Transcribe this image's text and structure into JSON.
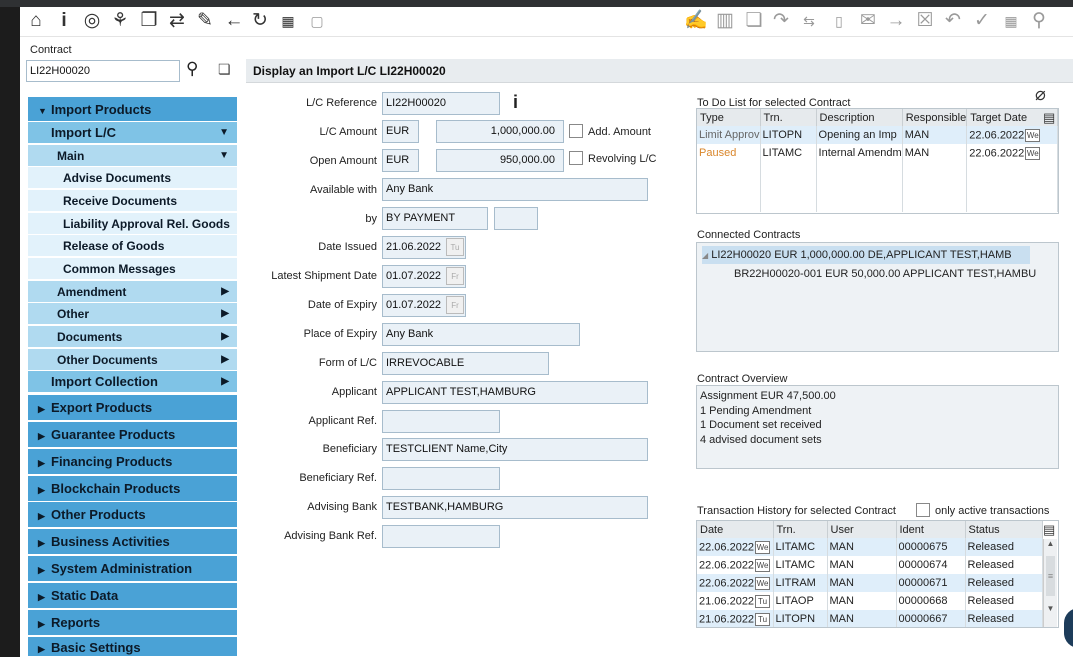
{
  "toolbar_left": [
    "home-icon",
    "info-icon",
    "swirl-icon",
    "tree-icon",
    "book-icon",
    "flow-icon",
    "edit-icon",
    "back-arrow-icon",
    "refresh-icon",
    "calendar-icon",
    "info-box-icon"
  ],
  "toolbar_right": [
    "edit-doc-icon",
    "trash-icon",
    "doc-edit-icon",
    "redo-icon",
    "swap-icon",
    "info-box-icon",
    "mail-icon",
    "forward-icon",
    "close-box-icon",
    "undo-icon",
    "check-icon",
    "calendar-icon",
    "search-icon"
  ],
  "contract": {
    "label": "Contract",
    "value": "LI22H00020"
  },
  "header": {
    "title": "Display an Import L/C LI22H00020"
  },
  "sidebar": {
    "import_products": "Import Products",
    "import_lc": "Import L/C",
    "main": "Main",
    "advise": "Advise Documents",
    "receive": "Receive Documents",
    "liability": "Liability Approval Rel. Goods",
    "release": "Release of Goods",
    "common": "Common Messages",
    "amendment": "Amendment",
    "other": "Other",
    "documents": "Documents",
    "other_documents": "Other Documents",
    "import_collection": "Import Collection",
    "export": "Export Products",
    "guarantee": "Guarantee Products",
    "financing": "Financing Products",
    "blockchain": "Blockchain Products",
    "other_products": "Other Products",
    "business": "Business Activities",
    "sysadmin": "System Administration",
    "static": "Static Data",
    "reports": "Reports",
    "basic": "Basic Settings"
  },
  "form": {
    "lc_reference": {
      "label": "L/C Reference",
      "value": "LI22H00020"
    },
    "lc_amount": {
      "label": "L/C Amount",
      "currency": "EUR",
      "value": "1,000,000.00",
      "add_label": "Add. Amount"
    },
    "open_amount": {
      "label": "Open Amount",
      "currency": "EUR",
      "value": "950,000.00",
      "revolving_label": "Revolving L/C"
    },
    "available_with": {
      "label": "Available with",
      "value": "Any Bank"
    },
    "by": {
      "label": "by",
      "value": "BY PAYMENT",
      "extra": ""
    },
    "date_issued": {
      "label": "Date Issued",
      "value": "21.06.2022",
      "day": "Tu"
    },
    "latest_shipment": {
      "label": "Latest Shipment Date",
      "value": "01.07.2022",
      "day": "Fr"
    },
    "date_expiry": {
      "label": "Date of Expiry",
      "value": "01.07.2022",
      "day": "Fr"
    },
    "place_expiry": {
      "label": "Place of Expiry",
      "value": "Any Bank"
    },
    "form_lc": {
      "label": "Form of L/C",
      "value": "IRREVOCABLE"
    },
    "applicant": {
      "label": "Applicant",
      "value": "APPLICANT TEST,HAMBURG"
    },
    "applicant_ref": {
      "label": "Applicant Ref.",
      "value": ""
    },
    "beneficiary": {
      "label": "Beneficiary",
      "value": "TESTCLIENT Name,City"
    },
    "beneficiary_ref": {
      "label": "Beneficiary Ref.",
      "value": ""
    },
    "advising_bank": {
      "label": "Advising Bank",
      "value": "TESTBANK,HAMBURG"
    },
    "advising_bank_ref": {
      "label": "Advising Bank Ref.",
      "value": ""
    }
  },
  "todo": {
    "title": "To Do List for selected Contract",
    "columns": [
      "Type",
      "Trn.",
      "Description",
      "Responsible",
      "Target Date"
    ],
    "rows": [
      {
        "type": "Limit Approv",
        "trn": "LITOPN",
        "desc": "Opening an Imp",
        "resp": "MAN",
        "date": "22.06.2022",
        "day": "We"
      },
      {
        "type": "Paused",
        "trn": "LITAMC",
        "desc": "Internal Amendm",
        "resp": "MAN",
        "date": "22.06.2022",
        "day": "We"
      }
    ]
  },
  "connected": {
    "title": "Connected Contracts",
    "items": [
      "LI22H00020 EUR 1,000,000.00 DE,APPLICANT TEST,HAMB",
      "BR22H00020-001 EUR 50,000.00 APPLICANT TEST,HAMBU"
    ]
  },
  "overview": {
    "title": "Contract Overview",
    "lines": [
      "Assignment EUR 47,500.00",
      "1 Pending Amendment",
      "1 Document set received",
      "4 advised document sets"
    ]
  },
  "history": {
    "title": "Transaction History for selected Contract",
    "only_active": "only active transactions",
    "columns": [
      "Date",
      "Trn.",
      "User",
      "Ident",
      "Status"
    ],
    "rows": [
      {
        "date": "22.06.2022",
        "day": "We",
        "trn": "LITAMC",
        "user": "MAN",
        "ident": "00000675",
        "status": "Released"
      },
      {
        "date": "22.06.2022",
        "day": "We",
        "trn": "LITAMC",
        "user": "MAN",
        "ident": "00000674",
        "status": "Released"
      },
      {
        "date": "22.06.2022",
        "day": "We",
        "trn": "LITRAM",
        "user": "MAN",
        "ident": "00000671",
        "status": "Released"
      },
      {
        "date": "21.06.2022",
        "day": "Tu",
        "trn": "LITAOP",
        "user": "MAN",
        "ident": "00000668",
        "status": "Released"
      },
      {
        "date": "21.06.2022",
        "day": "Tu",
        "trn": "LITOPN",
        "user": "MAN",
        "ident": "00000667",
        "status": "Released"
      }
    ]
  },
  "colors": {
    "nav_dark": "#4aa2d6",
    "nav_mid": "#7fc3e6",
    "paused": "#d9862b",
    "field_bg": "#eaf1f7",
    "left_strip": "#1c1c1c"
  }
}
